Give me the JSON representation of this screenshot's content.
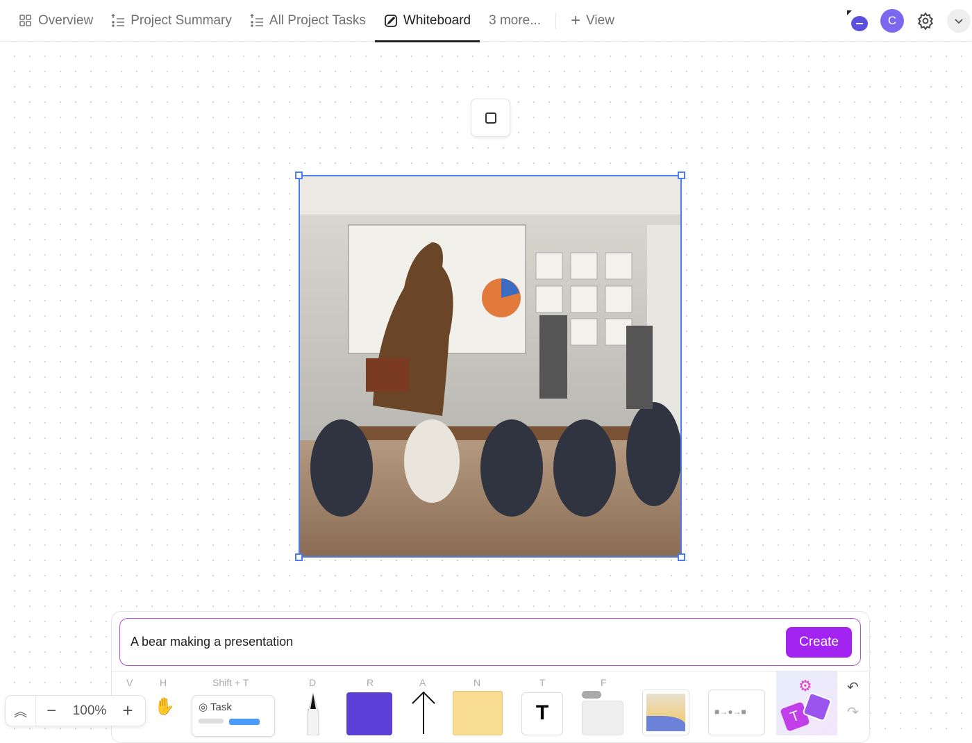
{
  "tabs": [
    {
      "label": "Overview",
      "icon": "grid-icon"
    },
    {
      "label": "Project Summary",
      "icon": "list-icon"
    },
    {
      "label": "All Project Tasks",
      "icon": "list-icon"
    },
    {
      "label": "Whiteboard",
      "icon": "whiteboard-icon",
      "active": true
    },
    {
      "label": "3 more..."
    }
  ],
  "add_view": "View",
  "user_initial": "C",
  "image_alt": "A bear making a presentation to animals in a meeting room",
  "prompt": {
    "value": "A bear making a presentation",
    "create_label": "Create"
  },
  "toolbar": {
    "keys": {
      "select": "V",
      "hand": "H",
      "task": "Shift + T",
      "draw": "D",
      "rect": "R",
      "arrow": "A",
      "note": "N",
      "text": "T",
      "frame": "F"
    },
    "task_label": "Task",
    "zoom": "100%"
  },
  "colors": {
    "accent": "#7b68ee",
    "create": "#a323f0",
    "selection": "#4a7df0",
    "rect": "#5b3fd6"
  }
}
